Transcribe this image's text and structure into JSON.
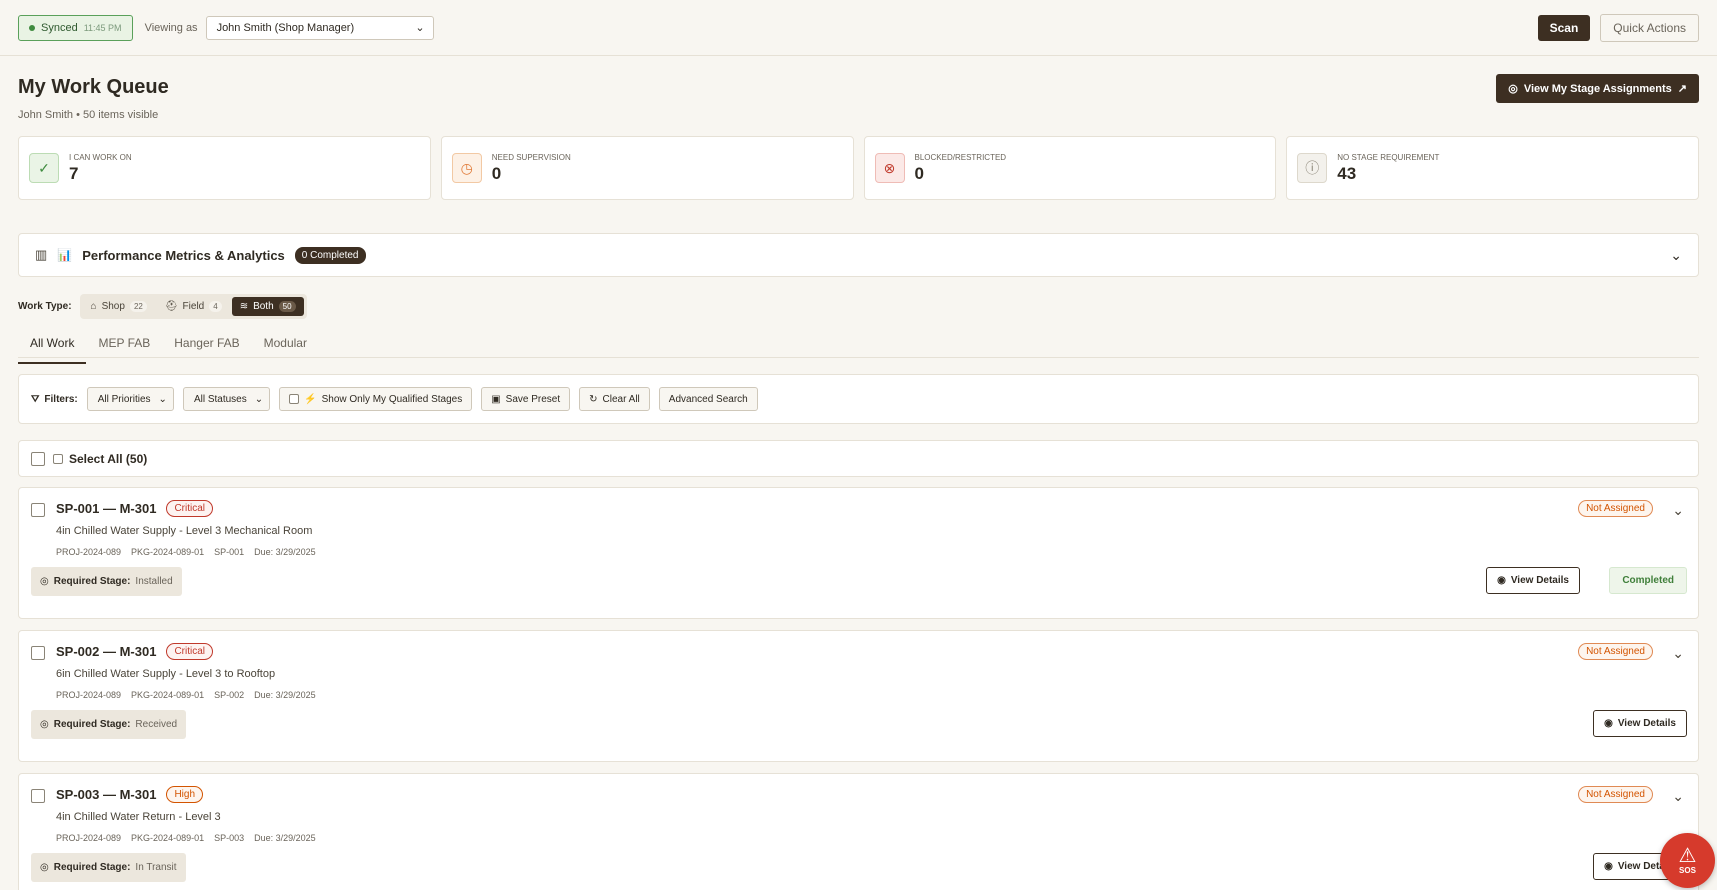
{
  "topbar": {
    "sync_status": "Synced",
    "sync_time": "11:45 PM",
    "viewing_label": "Viewing as",
    "viewing_value": "John Smith (Shop Manager)",
    "scan_label": "Scan",
    "quick_actions_label": "Quick Actions"
  },
  "header": {
    "title": "My Work Queue",
    "subtitle": "John Smith • 50 items visible",
    "stage_button": "View My Stage Assignments"
  },
  "stats": [
    {
      "label": "I CAN WORK ON",
      "value": "7",
      "icon": "check-circle-icon",
      "color": "#3f8b3f",
      "bg": "#eaf4e6"
    },
    {
      "label": "NEED SUPERVISION",
      "value": "0",
      "icon": "clock-icon",
      "color": "#e07b39",
      "bg": "#fdf1e6"
    },
    {
      "label": "BLOCKED/RESTRICTED",
      "value": "0",
      "icon": "x-circle-icon",
      "color": "#c0392b",
      "bg": "#fbe9e7"
    },
    {
      "label": "NO STAGE REQUIREMENT",
      "value": "43",
      "icon": "info-icon",
      "color": "#8a8477",
      "bg": "#f3f1ec"
    }
  ],
  "performance": {
    "title": "Performance Metrics & Analytics",
    "emoji": "📊",
    "badge": "0 Completed"
  },
  "work_type": {
    "label": "Work Type:",
    "options": [
      {
        "label": "Shop",
        "count": "22"
      },
      {
        "label": "Field",
        "count": "4"
      },
      {
        "label": "Both",
        "count": "50"
      }
    ]
  },
  "tabs": [
    "All Work",
    "MEP FAB",
    "Hanger FAB",
    "Modular"
  ],
  "filters": {
    "label": "Filters:",
    "priority": "All Priorities",
    "status": "All Statuses",
    "qualified": "Show Only My Qualified Stages",
    "save_preset": "Save Preset",
    "clear_all": "Clear All",
    "advanced": "Advanced Search"
  },
  "select_all": "Select All (50)",
  "items": [
    {
      "title": "SP-001 — M-301",
      "priority": "Critical",
      "desc": "4in Chilled Water Supply - Level 3 Mechanical Room",
      "project": "PROJ-2024-089",
      "package": "PKG-2024-089-01",
      "spool": "SP-001",
      "due": "Due: 3/29/2025",
      "stage_label": "Required Stage:",
      "stage_value": "Installed",
      "assignment": "Not Assigned",
      "view_label": "View Details",
      "status": "Completed"
    },
    {
      "title": "SP-002 — M-301",
      "priority": "Critical",
      "desc": "6in Chilled Water Supply - Level 3 to Rooftop",
      "project": "PROJ-2024-089",
      "package": "PKG-2024-089-01",
      "spool": "SP-002",
      "due": "Due: 3/29/2025",
      "stage_label": "Required Stage:",
      "stage_value": "Received",
      "assignment": "Not Assigned",
      "view_label": "View Details"
    },
    {
      "title": "SP-003 — M-301",
      "priority": "High",
      "desc": "4in Chilled Water Return - Level 3",
      "project": "PROJ-2024-089",
      "package": "PKG-2024-089-01",
      "spool": "SP-003",
      "due": "Due: 3/29/2025",
      "stage_label": "Required Stage:",
      "stage_value": "In Transit",
      "assignment": "Not Assigned",
      "view_label": "View Details"
    }
  ],
  "sos_label": "SOS"
}
